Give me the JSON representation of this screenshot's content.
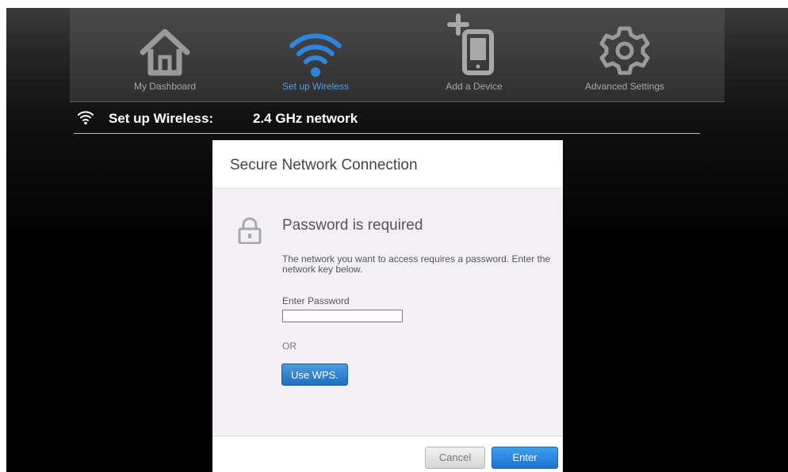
{
  "nav": {
    "items": [
      {
        "label": "My Dashboard",
        "icon": "home-icon"
      },
      {
        "label": "Set up Wireless",
        "icon": "wifi-icon",
        "active": true
      },
      {
        "label": "Add a Device",
        "icon": "add-device-icon"
      },
      {
        "label": "Advanced Settings",
        "icon": "gear-icon"
      }
    ]
  },
  "crumb": {
    "title": "Set up Wireless:",
    "subtitle": "2.4 GHz network",
    "icon": "wifi-icon"
  },
  "dialog": {
    "title": "Secure Network Connection",
    "heading": "Password is required",
    "icon": "lock-icon",
    "description": "The network you want to access requires a password. Enter the network key below.",
    "password_label": "Enter Password",
    "password_value": "",
    "or_text": "OR",
    "wps_button": "Use WPS.",
    "cancel_button": "Cancel",
    "enter_button": "Enter"
  },
  "colors": {
    "accent": "#2d86dc",
    "active_nav_label": "#4aa3e8",
    "nav_label": "#a8a8a8",
    "icon_gray": "#9a9a9a"
  }
}
